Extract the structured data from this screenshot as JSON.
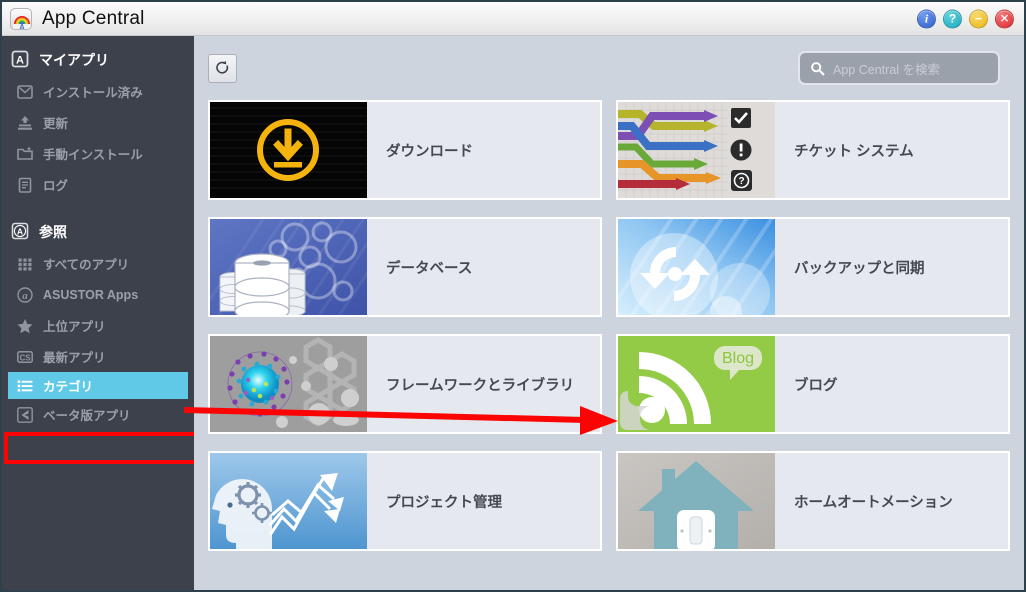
{
  "window": {
    "title": "App Central",
    "app_icon": "rainbow-a-icon",
    "buttons": [
      {
        "name": "info-button",
        "glyph": "i",
        "color": "#3a6fd8"
      },
      {
        "name": "help-button",
        "glyph": "?",
        "color": "#2bb8c4"
      },
      {
        "name": "minimize-button",
        "glyph": "−",
        "color": "#eab81b"
      },
      {
        "name": "close-button",
        "glyph": "✕",
        "color": "#dd2b2b"
      }
    ]
  },
  "sidebar": {
    "groups": [
      {
        "header": {
          "label": "マイアプリ",
          "icon": "boxed-a-icon"
        },
        "items": [
          {
            "label": "インストール済み",
            "icon": "installed-box-icon",
            "selected": false
          },
          {
            "label": "更新",
            "icon": "update-upload-icon",
            "selected": false
          },
          {
            "label": "手動インストール",
            "icon": "folder-plus-icon",
            "selected": false
          },
          {
            "label": "ログ",
            "icon": "log-document-icon",
            "selected": false
          }
        ]
      },
      {
        "header": {
          "label": "参照",
          "icon": "circled-a-icon"
        },
        "items": [
          {
            "label": "すべてのアプリ",
            "icon": "grid-icon",
            "selected": false
          },
          {
            "label": "ASUSTOR Apps",
            "icon": "asustor-a-icon",
            "selected": false
          },
          {
            "label": "上位アプリ",
            "icon": "star-icon",
            "selected": false
          },
          {
            "label": "最新アプリ",
            "icon": "latest-cs-icon",
            "selected": false
          },
          {
            "label": "カテゴリ",
            "icon": "category-list-icon",
            "selected": true
          },
          {
            "label": "ベータ版アプリ",
            "icon": "beta-arrow-icon",
            "selected": false
          }
        ]
      }
    ]
  },
  "toolbar": {
    "refresh_icon": "refresh-icon",
    "search": {
      "icon": "search-icon",
      "placeholder": "App Central を検索",
      "value": ""
    }
  },
  "categories": [
    {
      "label": "ダウンロード",
      "thumb": "download-thumb",
      "highlighted": false
    },
    {
      "label": "チケット システム",
      "thumb": "ticket-system-thumb",
      "highlighted": false
    },
    {
      "label": "データベース",
      "thumb": "database-thumb",
      "highlighted": false
    },
    {
      "label": "バックアップと同期",
      "thumb": "backup-sync-thumb",
      "highlighted": false
    },
    {
      "label": "フレームワークとライブラリ",
      "thumb": "framework-thumb",
      "highlighted": false
    },
    {
      "label": "ブログ",
      "thumb": "blog-thumb",
      "highlighted": true
    },
    {
      "label": "プロジェクト管理",
      "thumb": "project-mgmt-thumb",
      "highlighted": false
    },
    {
      "label": "ホームオートメーション",
      "thumb": "home-automation-thumb",
      "highlighted": false
    }
  ],
  "annotations": {
    "arrow": {
      "name": "red-pointer-arrow",
      "color": "#fc0404",
      "from": "カテゴリ",
      "to": "ブログ"
    },
    "highlight_color": "#fc0404",
    "selection_color": "#61c9e8"
  },
  "blog_thumb_badge": "Blog"
}
